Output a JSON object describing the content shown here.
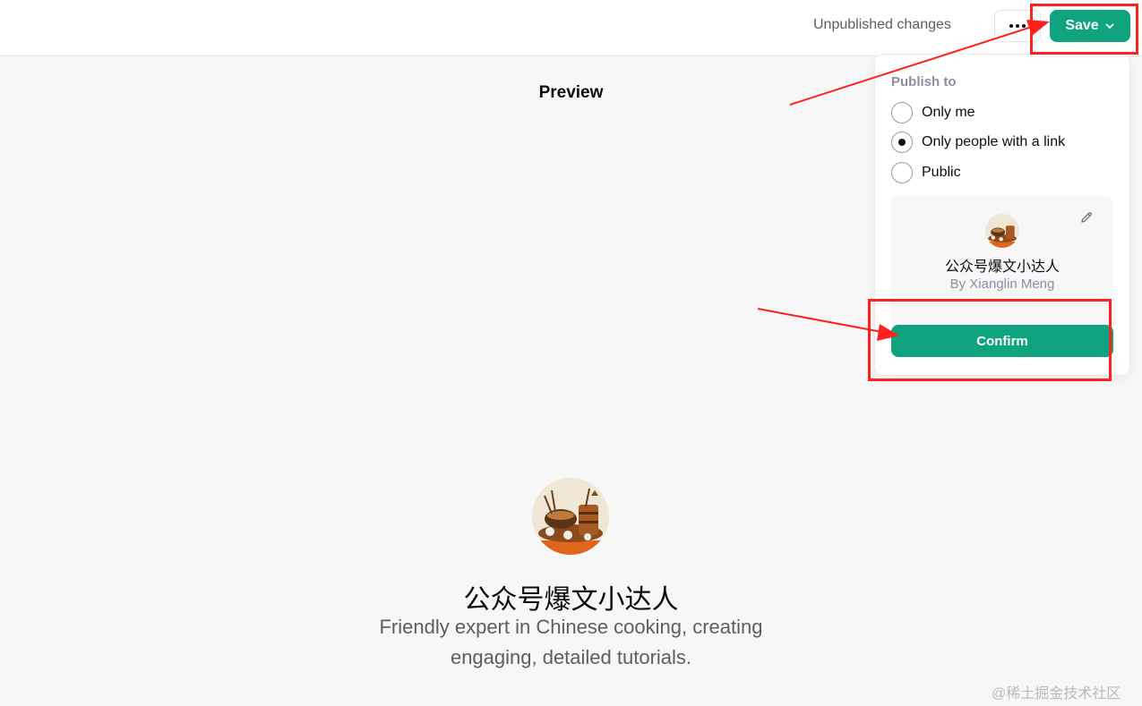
{
  "header": {
    "status": "Unpublished changes",
    "more_icon": "more-horizontal-icon",
    "save_label": "Save"
  },
  "preview": {
    "title": "Preview"
  },
  "publish_menu": {
    "label": "Publish to",
    "options": [
      {
        "label": "Only me",
        "selected": false
      },
      {
        "label": "Only people with a link",
        "selected": true
      },
      {
        "label": "Public",
        "selected": false
      }
    ],
    "card": {
      "name": "公众号爆文小达人",
      "author": "By Xianglin Meng"
    },
    "confirm_label": "Confirm"
  },
  "gpt": {
    "name": "公众号爆文小达人",
    "description": "Friendly expert in Chinese cooking, creating engaging, detailed tutorials."
  },
  "watermark": "@稀土掘金技术社区",
  "colors": {
    "accent": "#10a37f",
    "annotation": "#ff2020"
  }
}
